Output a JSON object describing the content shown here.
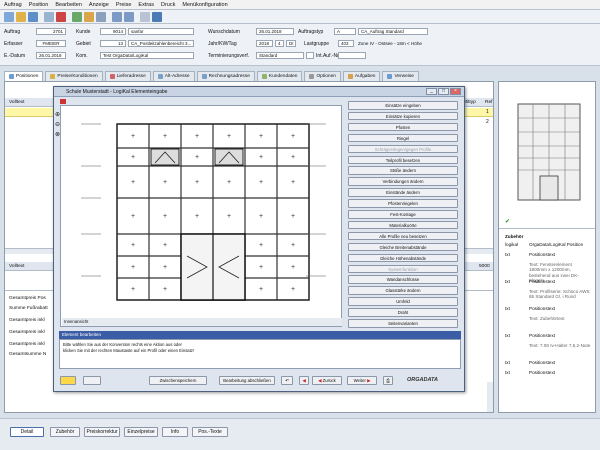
{
  "menu": [
    "Auftrag",
    "Position",
    "Bearbeiten",
    "Anzeige",
    "Preise",
    "Extras",
    "Druck",
    "Menükonfiguration"
  ],
  "header": {
    "auftrag_label": "Auftrag",
    "auftrag_value": "2701",
    "kunde_label": "Kunde",
    "kunde_value": "9014",
    "kunde_name": "sanfar",
    "wunschdatum_label": "Wunschdatum",
    "wunschdatum_value": "26.01.2018",
    "auftragstyp_label": "Auftragstyp",
    "auftragstyp_value": "A",
    "auftragstyp_name": "CA_Auftrag Standard",
    "erfasser_label": "Erfasser",
    "erfasser_value": "FMEIER",
    "gebiet_label": "Gebiet",
    "gebiet_value": "13",
    "gebiet_name": "CA_PostleitzahlenbereichI 3...",
    "jahr_label": "Jahr/KW/Tag",
    "jahr_value": "2018",
    "kw_value": "4",
    "tag_value": "DI",
    "lastgruppe_label": "Lastgruppe",
    "lastgruppe_value": "403",
    "lastgruppe_name": "Zone IV - Ostsee - 18m < Höhe",
    "edatum_label": "E.-Datum",
    "edatum_value": "26.01.2018",
    "kom_label": "Kom.",
    "kom_value": "Test OrgaData/LogiKal",
    "termin_label": "Terminierungsverf.",
    "termin_value": "Standard",
    "intauf_label": "Int.Auf.-Nr."
  },
  "tabs": [
    "Positionen",
    "Preise/Konditionen",
    "Lieferadresse",
    "Alt-Adresse",
    "Rechnungsadresse",
    "Kundendaten",
    "Optionen",
    "Aufgaben",
    "Verweise"
  ],
  "main": {
    "col_volltext": "Volltext",
    "col_mittyp": "Mittyp",
    "col_ref": "Ref",
    "ref_values": [
      "1",
      "2"
    ],
    "volltext2": "Volltext",
    "ref_value3": "5000",
    "summary": [
      "Gesamtpreis Pos",
      "Summe Fußrabatt",
      "Gesamtpreis inkl",
      "Gesamtpreis inkl",
      "Gesamtpreis inkl",
      "Gesamtsumme N"
    ]
  },
  "dialog": {
    "title": "Schule Musterstadt - LogiKal Elementeingabe",
    "canvas_label": "Innenansicht",
    "buttons": [
      "Einsätze eingeben",
      "Einsätze kopieren",
      "Pfosten",
      "Riegel",
      "Schrägverlegen/gegen Profile",
      "Teilprofil besetzen",
      "Stöße ändern",
      "Verbindungen ändern",
      "Einstände ändern",
      "Pfostenriegelen",
      "Fest-Kostage",
      "Materialkuörte",
      "Alle Profile neu besetzen",
      "Gleiche Breitenabstände",
      "Gleiche Höhenabstände",
      "Systemfunktion",
      "Wandanschlüsse",
      "Glasstärke ändern",
      "Umfeld",
      "Draht",
      "Seitenvarianten"
    ],
    "disabled": [
      4,
      15
    ],
    "msg_title": "Element bearbeiten",
    "msg_text1": "Bitte wählen Sie aus der Konvention rechts eine Aktion aus oder",
    "msg_text2": "klicken Sie mit der rechten Maustaste auf ein Profil oder einen Einsatz!",
    "btn_zwischenspeichern": "Zwischenspeichern",
    "btn_abschliessen": "Bearbeitung abschließen",
    "btn_zurueck": "Zurück",
    "btn_weiter": "Weiter",
    "logo": "ORGADATA"
  },
  "zubehor": {
    "title": "Zubehör",
    "rows": [
      {
        "k": "logikal",
        "v": "OrgaData/LogiKal Position"
      },
      {
        "k": "txt",
        "v": "Positionstext"
      },
      {
        "k": "",
        "v": "Text: Fensterelement 1800mm x 1200mm, bestehend aus zwei DK-Flügeln."
      },
      {
        "k": "txt",
        "v": "Positionstext"
      },
      {
        "k": "",
        "v": "Text: Profilserie: Schüco AWS 65 Standard Gl. i Rund"
      },
      {
        "k": "txt",
        "v": "Positionstext"
      },
      {
        "k": "",
        "v": "Text: Zubehörtext"
      },
      {
        "k": "txt",
        "v": "Positionstext"
      },
      {
        "k": "",
        "v": "Text: 7.06 Iv-Halter 7,6,2-Nute"
      },
      {
        "k": "txt",
        "v": "Positionstext"
      },
      {
        "k": "txt",
        "v": "Positionstext"
      }
    ]
  },
  "bottomnav": [
    "Detail",
    "Zubehör",
    "Preiskorrektur",
    "Einzelpreise",
    "Info",
    "Pos.-Texte"
  ]
}
